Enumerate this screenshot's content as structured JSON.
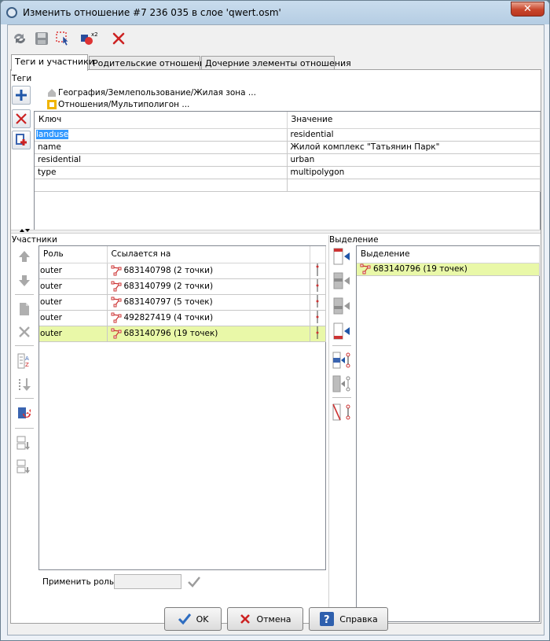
{
  "window": {
    "title": "Изменить отношение #7 236 035 в слое 'qwert.osm'",
    "close_glyph": "✕"
  },
  "toolbar": {
    "icons": [
      "refresh-icon",
      "save-icon",
      "select-members-icon",
      "duplicate-relation-icon",
      "delete-relation-icon"
    ]
  },
  "tabs": [
    {
      "label": "Теги и участники",
      "active": true
    },
    {
      "label": "Родительские отношения",
      "active": false
    },
    {
      "label": "Дочерние элементы отношения",
      "active": false
    }
  ],
  "tags": {
    "section_label": "Теги",
    "presets": [
      "География/Землепользование/Жилая зона ...",
      "Отношения/Мультиполигон ..."
    ],
    "columns": {
      "key": "Ключ",
      "value": "Значение"
    },
    "rows": [
      {
        "key": "landuse",
        "value": "residential"
      },
      {
        "key": "name",
        "value": "Жилой комплекс \"Татьянин Парк\""
      },
      {
        "key": "residential",
        "value": "urban"
      },
      {
        "key": "type",
        "value": "multipolygon"
      },
      {
        "key": "",
        "value": ""
      }
    ]
  },
  "members": {
    "section_label": "Участники",
    "columns": {
      "role": "Роль",
      "ref": "Ссылается на"
    },
    "rows": [
      {
        "role": "outer",
        "ref": "683140798 (2 точки)",
        "highlight": false
      },
      {
        "role": "outer",
        "ref": "683140799 (2 точки)",
        "highlight": false
      },
      {
        "role": "outer",
        "ref": "683140797 (5 точек)",
        "highlight": false
      },
      {
        "role": "outer",
        "ref": "492827419 (4 точки)",
        "highlight": false
      },
      {
        "role": "outer",
        "ref": "683140796 (19 точек)",
        "highlight": true
      }
    ],
    "apply_role_label": "Применить роль:",
    "apply_role_value": ""
  },
  "selection": {
    "section_label": "Выделение",
    "column": "Выделение",
    "rows": [
      {
        "ref": "683140796 (19 точек)",
        "highlight": true
      }
    ]
  },
  "buttons": {
    "ok": "OK",
    "cancel": "Отмена",
    "help": "Справка"
  },
  "colors": {
    "selected_cell": "#3399ff",
    "highlight_row": "#e9f8a8",
    "close_button": "#c8452b"
  }
}
